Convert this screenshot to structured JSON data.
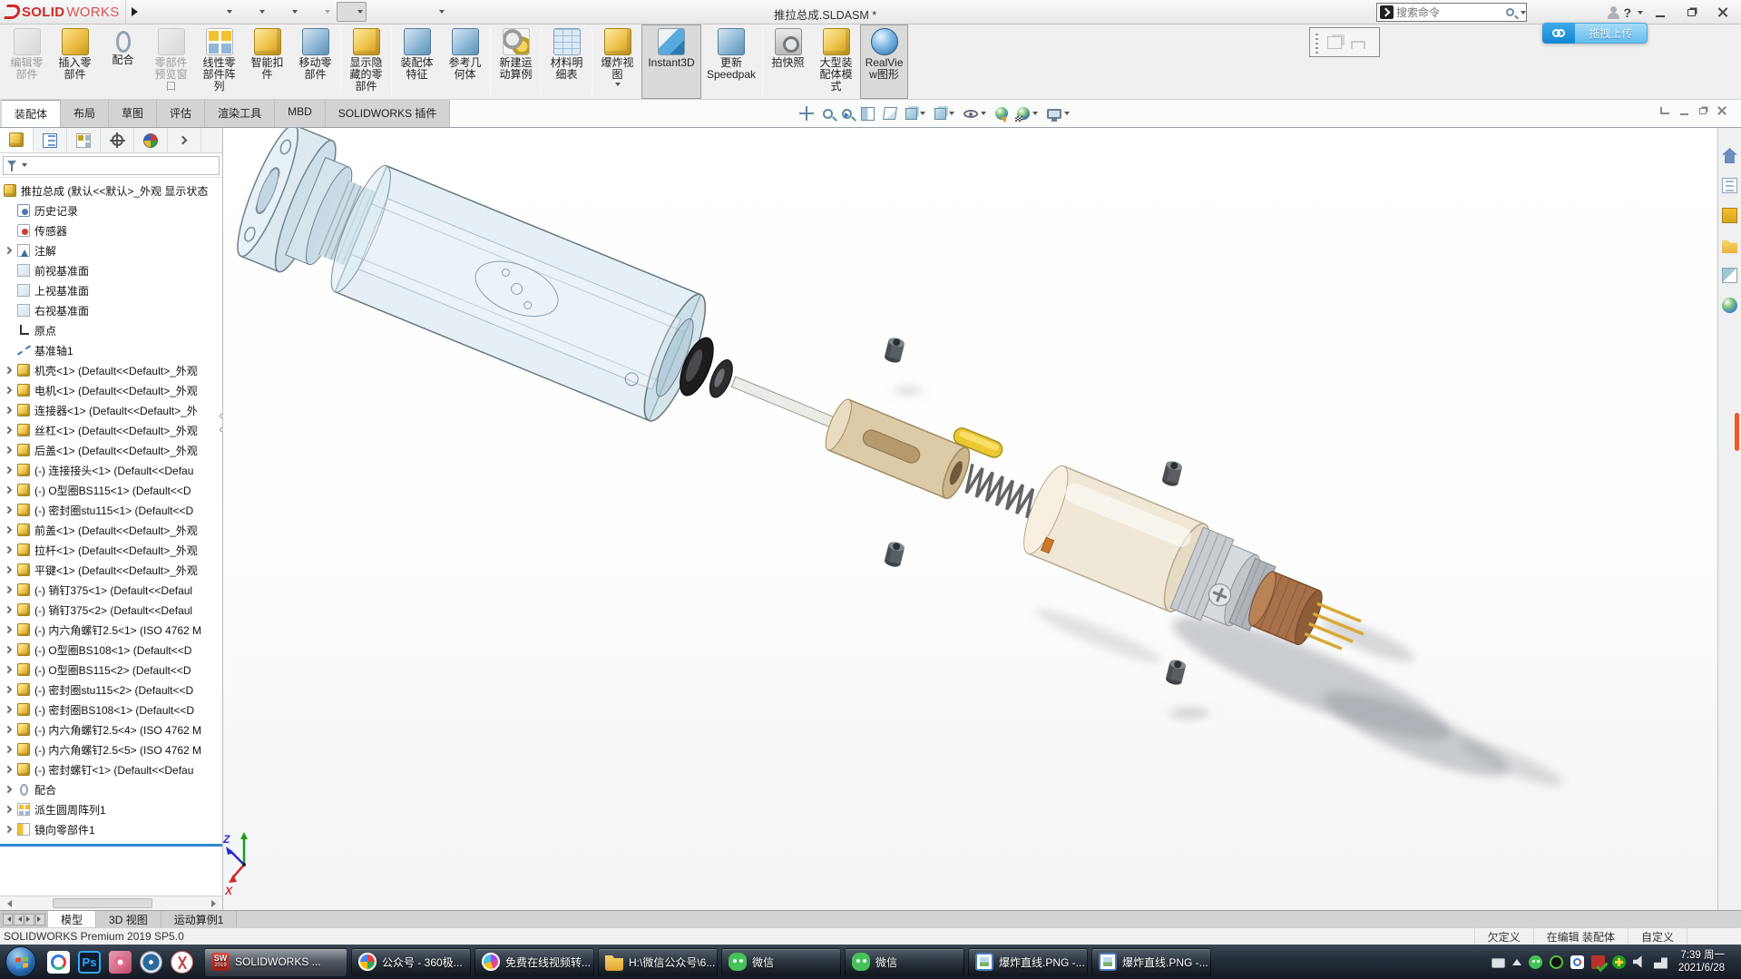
{
  "titlebar": {
    "logo_strong": "SOLID",
    "logo_light": "WORKS",
    "title": "推拉总成.SLDASM *",
    "search_placeholder": "搜索命令",
    "quick_access": [
      {
        "icon": "home-icon",
        "variant": "home"
      },
      {
        "icon": "new-file-icon",
        "variant": "newfile"
      },
      {
        "icon": "open-file-icon",
        "variant": "openfile",
        "arrow": true
      },
      {
        "icon": "save-icon",
        "variant": "save",
        "arrow": true
      },
      {
        "icon": "print-icon",
        "variant": "print",
        "arrow": true
      },
      {
        "icon": "undo-icon",
        "variant": "undo",
        "arrow": true,
        "state": "disabled"
      },
      {
        "icon": "select-cursor-icon",
        "variant": "select",
        "arrow": true,
        "state": "active"
      },
      {
        "icon": "rebuild-icon",
        "variant": "rebuild"
      },
      {
        "icon": "file-properties-icon",
        "variant": "fileprops"
      },
      {
        "icon": "options-icon",
        "variant": "gear",
        "arrow": true
      }
    ]
  },
  "upload_badge": {
    "label": "拖拽上传"
  },
  "ribbon": {
    "buttons": [
      {
        "label": "编辑零部件",
        "icon": "edit-component-icon",
        "variant": "gray",
        "state": "disabled"
      },
      {
        "label": "插入零部件",
        "icon": "insert-components-icon",
        "variant": "yellow"
      },
      {
        "label": "配合",
        "icon": "mate-icon",
        "variant": "clip"
      },
      {
        "label": "零部件预览窗口",
        "icon": "component-preview-window-icon",
        "variant": "gray",
        "state": "disabled"
      },
      {
        "label": "线性零部件阵列",
        "icon": "linear-component-pattern-icon",
        "variant": "pattern"
      },
      {
        "label": "智能扣件",
        "icon": "smart-fasteners-icon",
        "variant": "yellow2"
      },
      {
        "label": "移动零部件",
        "icon": "move-component-icon",
        "variant": "blue",
        "sep_after": true
      },
      {
        "label": "显示隐藏的零部件",
        "icon": "show-hidden-components-icon",
        "variant": "yellow2",
        "sep_after": true
      },
      {
        "label": "装配体特征",
        "icon": "assembly-features-icon",
        "variant": "blue"
      },
      {
        "label": "参考几何体",
        "icon": "reference-geometry-icon",
        "variant": "blue",
        "sep_after": true
      },
      {
        "label": "新建运动算例",
        "icon": "new-motion-study-icon",
        "variant": "gears",
        "sep_after": true
      },
      {
        "label": "材料明细表",
        "icon": "bill-of-materials-icon",
        "variant": "table",
        "sep_after": true
      },
      {
        "label": "爆炸视图",
        "icon": "exploded-view-icon",
        "variant": "yellow2",
        "arrow": true
      },
      {
        "label": "Instant3D",
        "icon": "instant3d-icon",
        "variant": "ruler",
        "state": "active",
        "w": "wide"
      },
      {
        "label": "更新Speedpak",
        "icon": "update-speedpak-icon",
        "variant": "blue",
        "sep_after": true,
        "w": "wide"
      },
      {
        "label": "拍快照",
        "icon": "take-snapshot-icon",
        "variant": "camera"
      },
      {
        "label": "大型装配体模式",
        "icon": "large-assembly-mode-icon",
        "variant": "yellow2"
      },
      {
        "label": "RealView图形",
        "icon": "realview-graphics-icon",
        "variant": "sphere",
        "state": "active"
      }
    ]
  },
  "command_tabs": {
    "items": [
      {
        "label": "装配体",
        "state": "active"
      },
      {
        "label": "布局"
      },
      {
        "label": "草图"
      },
      {
        "label": "评估"
      },
      {
        "label": "渲染工具"
      },
      {
        "label": "MBD"
      },
      {
        "label": "SOLIDWORKS 插件"
      }
    ]
  },
  "hud": {
    "icons": [
      {
        "icon": "zoom-to-fit-icon",
        "variant": "fit"
      },
      {
        "icon": "zoom-to-area-icon",
        "variant": "zoomarea"
      },
      {
        "icon": "previous-view-icon",
        "variant": "prevview"
      },
      {
        "icon": "section-view-icon",
        "variant": "section"
      },
      {
        "icon": "dynamic-annotation-views-icon",
        "variant": "anno"
      },
      {
        "icon": "view-orientation-icon",
        "variant": "cube",
        "arrow": true
      },
      {
        "icon": "display-style-icon",
        "variant": "cube",
        "arrow": true
      },
      {
        "icon": "hide-show-items-icon",
        "variant": "eye",
        "arrow": true
      },
      {
        "icon": "edit-appearance-icon",
        "variant": "appearance"
      },
      {
        "icon": "apply-scene-icon",
        "variant": "scene",
        "arrow": true
      },
      {
        "icon": "view-settings-icon",
        "variant": "monitor",
        "arrow": true
      }
    ]
  },
  "doc_controls": [
    {
      "icon": "previous-window-icon",
      "variant": "wc-back"
    },
    {
      "icon": "minimize-document-icon",
      "variant": "wc-min"
    },
    {
      "icon": "restore-document-icon",
      "variant": "wc-restore"
    },
    {
      "icon": "close-document-icon",
      "variant": "wc-close"
    }
  ],
  "feature_tree": {
    "root_label": "推拉总成 (默认<<默认>_外观 显示状态",
    "items": [
      {
        "icon": "history-icon",
        "variant": "history",
        "label": "历史记录",
        "exp": false
      },
      {
        "icon": "sensors-icon",
        "variant": "sensors",
        "label": "传感器",
        "exp": false
      },
      {
        "icon": "annotations-icon",
        "variant": "annotations",
        "label": "注解",
        "exp": true
      },
      {
        "icon": "plane-icon",
        "variant": "plane",
        "label": "前视基准面",
        "exp": false
      },
      {
        "icon": "plane-icon",
        "variant": "plane",
        "label": "上视基准面",
        "exp": false
      },
      {
        "icon": "plane-icon",
        "variant": "plane",
        "label": "右视基准面",
        "exp": false
      },
      {
        "icon": "origin-icon",
        "variant": "origin",
        "label": "原点",
        "exp": false
      },
      {
        "icon": "axis-icon",
        "variant": "axis",
        "label": "基准轴1",
        "exp": false
      },
      {
        "icon": "part-icon",
        "variant": "part",
        "label": "机壳<1> (Default<<Default>_外观",
        "exp": true
      },
      {
        "icon": "part-icon",
        "variant": "part",
        "label": "电机<1> (Default<<Default>_外观",
        "exp": true
      },
      {
        "icon": "part-icon",
        "variant": "part",
        "label": "连接器<1> (Default<<Default>_外",
        "exp": true
      },
      {
        "icon": "part-icon",
        "variant": "part",
        "label": "丝杠<1> (Default<<Default>_外观",
        "exp": true
      },
      {
        "icon": "part-icon",
        "variant": "part",
        "label": "后盖<1> (Default<<Default>_外观",
        "exp": true
      },
      {
        "icon": "part-icon",
        "variant": "part",
        "label": "(-) 连接接头<1> (Default<<Defau",
        "exp": true
      },
      {
        "icon": "part-icon",
        "variant": "part",
        "label": "(-) O型圈BS115<1> (Default<<D",
        "exp": true
      },
      {
        "icon": "part-icon",
        "variant": "part",
        "label": "(-) 密封圈stu115<1> (Default<<D",
        "exp": true
      },
      {
        "icon": "part-icon",
        "variant": "part",
        "label": "前盖<1> (Default<<Default>_外观",
        "exp": true
      },
      {
        "icon": "part-icon",
        "variant": "part",
        "label": "拉杆<1> (Default<<Default>_外观",
        "exp": true
      },
      {
        "icon": "part-icon",
        "variant": "part",
        "label": "平键<1> (Default<<Default>_外观",
        "exp": true
      },
      {
        "icon": "part-icon",
        "variant": "part",
        "label": "(-) 销钉375<1> (Default<<Defaul",
        "exp": true
      },
      {
        "icon": "part-icon",
        "variant": "part",
        "label": "(-) 销钉375<2> (Default<<Defaul",
        "exp": true
      },
      {
        "icon": "part-icon",
        "variant": "part",
        "label": "(-) 内六角螺钉2.5<1> (ISO 4762 M",
        "exp": true
      },
      {
        "icon": "part-icon",
        "variant": "part",
        "label": "(-) O型圈BS108<1> (Default<<D",
        "exp": true
      },
      {
        "icon": "part-icon",
        "variant": "part",
        "label": "(-) O型圈BS115<2> (Default<<D",
        "exp": true
      },
      {
        "icon": "part-icon",
        "variant": "part",
        "label": "(-) 密封圈stu115<2> (Default<<D",
        "exp": true
      },
      {
        "icon": "part-icon",
        "variant": "part",
        "label": "(-) 密封圈BS108<1> (Default<<D",
        "exp": true
      },
      {
        "icon": "part-icon",
        "variant": "part",
        "label": "(-) 内六角螺钉2.5<4> (ISO 4762 M",
        "exp": true
      },
      {
        "icon": "part-icon",
        "variant": "part",
        "label": "(-) 内六角螺钉2.5<5> (ISO 4762 M",
        "exp": true
      },
      {
        "icon": "part-icon",
        "variant": "part",
        "label": "(-) 密封螺钉<1> (Default<<Defau",
        "exp": true
      },
      {
        "icon": "mates-icon",
        "variant": "mates",
        "label": "配合",
        "exp": true
      },
      {
        "icon": "pattern-icon",
        "variant": "pattern",
        "label": "派生圆周阵列1",
        "exp": true
      },
      {
        "icon": "mirror-icon",
        "variant": "mirror",
        "label": "镜向零部件1",
        "exp": true
      }
    ]
  },
  "panel_tabs": [
    {
      "icon": "featuremanager-tab-icon",
      "variant": "asmcube",
      "state": "active"
    },
    {
      "icon": "propertymanager-tab-icon",
      "variant": "proplist"
    },
    {
      "icon": "configurationmanager-tab-icon",
      "variant": "config"
    },
    {
      "icon": "dimxpertmanager-tab-icon",
      "variant": "dimx"
    },
    {
      "icon": "displaymanager-tab-icon",
      "variant": "colorwheel"
    },
    {
      "icon": "expand-pane-icon",
      "variant": "chev"
    }
  ],
  "taskpane": {
    "icons": [
      {
        "icon": "home-icon",
        "variant": "home"
      },
      {
        "icon": "solidworks-resources-icon",
        "variant": "res"
      },
      {
        "icon": "design-library-icon",
        "variant": "lib"
      },
      {
        "icon": "file-explorer-icon",
        "variant": "folder"
      },
      {
        "icon": "view-palette-icon",
        "variant": "palette"
      },
      {
        "icon": "appearances-scenes-icon",
        "variant": "appear"
      }
    ]
  },
  "viewport": {
    "triad": {
      "x_label": "X",
      "z_label": "Z"
    }
  },
  "doc_tabs": {
    "items": [
      {
        "label": "模型",
        "state": "active"
      },
      {
        "label": "3D 视图"
      },
      {
        "label": "运动算例1"
      }
    ]
  },
  "statusbar": {
    "app": "SOLIDWORKS Premium 2019 SP5.0",
    "constraint_status": "欠定义",
    "edit_mode": "在编辑 装配体",
    "custom": "自定义"
  },
  "taskbar": {
    "quick_launch": [
      {
        "icon": "baidu-netdisk-icon",
        "variant": "netdisk"
      },
      {
        "icon": "photoshop-icon",
        "variant": "ps",
        "label": "Ps"
      },
      {
        "icon": "image-viewer-app-icon",
        "variant": "photo"
      },
      {
        "icon": "camera-app-icon",
        "variant": "lens"
      },
      {
        "icon": "screenshot-tool-icon",
        "variant": "snip"
      }
    ],
    "buttons": [
      {
        "icon": "solidworks-task-icon",
        "variant": "sw",
        "icon_text": "SW",
        "icon_sub": "2019",
        "label": "SOLIDWORKS ...",
        "state": "active"
      },
      {
        "icon": "browser-360-icon",
        "variant": "360",
        "label": "公众号 - 360极..."
      },
      {
        "icon": "video-converter-icon",
        "variant": "video",
        "label": "免费在线视频转..."
      },
      {
        "icon": "folder-window-icon",
        "variant": "folder",
        "label": "H:\\微信公众号\\6..."
      },
      {
        "icon": "wechat-icon",
        "variant": "wechat",
        "label": "微信"
      },
      {
        "icon": "wechat-icon",
        "variant": "wechat",
        "label": "微信"
      },
      {
        "icon": "image-viewer-icon",
        "variant": "image",
        "label": "爆炸直线.PNG -..."
      },
      {
        "icon": "image-viewer-icon",
        "variant": "image",
        "label": "爆炸直线.PNG -..."
      }
    ],
    "tray": [
      {
        "icon": "keyboard-icon",
        "variant": "kbd"
      },
      {
        "icon": "show-hidden-icons-icon",
        "variant": "up"
      },
      {
        "icon": "wechat-tray-icon",
        "variant": "wechat"
      },
      {
        "icon": "screen-recorder-tray-icon",
        "variant": "recorder"
      },
      {
        "icon": "baidu-netdisk-tray-icon",
        "variant": "netdisk"
      },
      {
        "icon": "solidworks-rx-tray-icon",
        "variant": "swcheck"
      },
      {
        "icon": "antivirus-tray-icon",
        "variant": "plus"
      },
      {
        "icon": "volume-icon",
        "variant": "volume"
      },
      {
        "icon": "network-icon",
        "variant": "network"
      }
    ],
    "clock": {
      "time": "7:39 周一",
      "date": "2021/6/28"
    }
  }
}
